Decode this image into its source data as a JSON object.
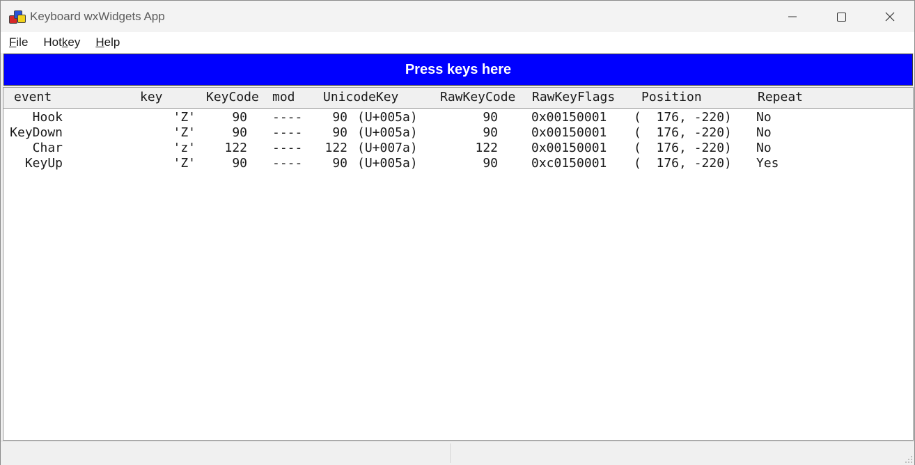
{
  "window": {
    "title": "Keyboard wxWidgets App"
  },
  "menu": {
    "items": [
      {
        "label": "File",
        "mnemonic_index": 0
      },
      {
        "label": "Hotkey",
        "mnemonic_index": 3
      },
      {
        "label": "Help",
        "mnemonic_index": 0
      }
    ]
  },
  "banner": {
    "text": "Press keys here",
    "color": "#0000ff"
  },
  "log": {
    "headers": {
      "event": "event",
      "key": "key",
      "keycode": "KeyCode",
      "mod": "mod",
      "unicode": "UnicodeKey",
      "rawkeycode": "RawKeyCode",
      "rawflags": "RawKeyFlags",
      "position": "Position",
      "repeat": "Repeat"
    },
    "rows": [
      {
        "event": "Hook",
        "key": "'Z'",
        "keycode": "90",
        "mod": "----",
        "unicode_code": "90",
        "unicode_hex": "(U+005a)",
        "rawkeycode": "90",
        "rawflags": "0x00150001",
        "position": "(  176, -220)",
        "repeat": "No"
      },
      {
        "event": "KeyDown",
        "key": "'Z'",
        "keycode": "90",
        "mod": "----",
        "unicode_code": "90",
        "unicode_hex": "(U+005a)",
        "rawkeycode": "90",
        "rawflags": "0x00150001",
        "position": "(  176, -220)",
        "repeat": "No"
      },
      {
        "event": "Char",
        "key": "'z'",
        "keycode": "122",
        "mod": "----",
        "unicode_code": "122",
        "unicode_hex": "(U+007a)",
        "rawkeycode": "122",
        "rawflags": "0x00150001",
        "position": "(  176, -220)",
        "repeat": "No"
      },
      {
        "event": "KeyUp",
        "key": "'Z'",
        "keycode": "90",
        "mod": "----",
        "unicode_code": "90",
        "unicode_hex": "(U+005a)",
        "rawkeycode": "90",
        "rawflags": "0xc0150001",
        "position": "(  176, -220)",
        "repeat": "Yes"
      }
    ]
  },
  "icons": {
    "app": "wx-app-icon",
    "minimize": "minimize-icon",
    "maximize": "maximize-icon",
    "close": "close-icon",
    "grip": "resize-grip-icon"
  }
}
